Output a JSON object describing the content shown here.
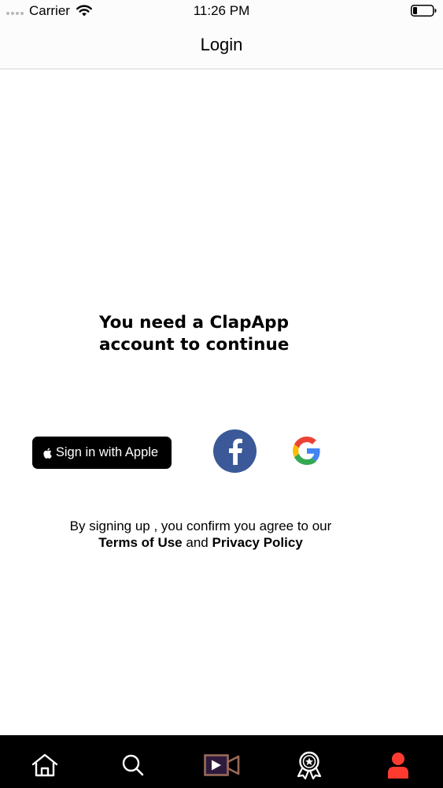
{
  "status_bar": {
    "carrier": "Carrier",
    "time": "11:26 PM"
  },
  "nav": {
    "title": "Login"
  },
  "main": {
    "headline_line1": "You need a ClapApp",
    "headline_line2": "account to continue",
    "apple_label": "Sign in with Apple",
    "terms_prefix": "By signing up , you confirm you agree to our",
    "terms_of_use": "Terms of Use",
    "terms_and": "and",
    "privacy_policy": "Privacy Policy"
  },
  "tab_bar": {
    "tabs": [
      {
        "icon": "home-icon"
      },
      {
        "icon": "search-icon"
      },
      {
        "icon": "video-icon"
      },
      {
        "icon": "award-icon"
      },
      {
        "icon": "profile-icon"
      }
    ]
  },
  "colors": {
    "facebook": "#3b5998",
    "video_accent": "#9a6a58",
    "profile_active": "#ff3b30",
    "tab_bar_bg": "#000000"
  }
}
